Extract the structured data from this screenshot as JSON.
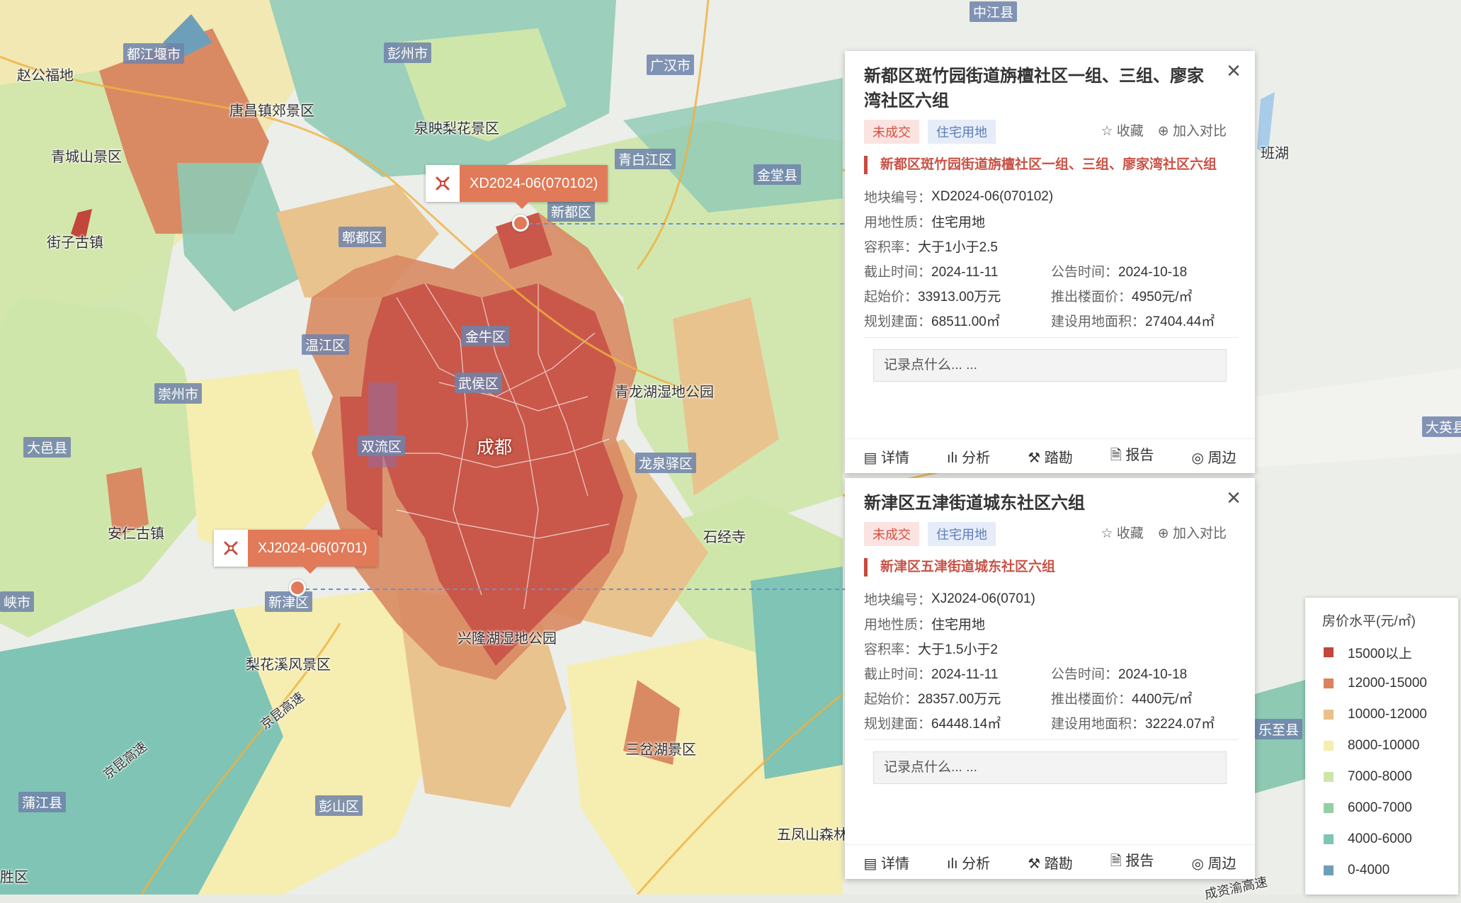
{
  "map_labels": {
    "places": [
      "赵公福地",
      "唐昌镇郊景区",
      "泉映梨花景区",
      "青城山景区",
      "街子古镇",
      "安仁古镇",
      "青龙湖湿地公园",
      "石经寺",
      "兴隆湖湿地公园",
      "梨花溪风景区",
      "三岔湖景区",
      "五凤山森林",
      "班湖"
    ],
    "districts": [
      "都江堰市",
      "彭州市",
      "广汉市",
      "中江县",
      "青白江区",
      "金堂县",
      "新都区",
      "郫都区",
      "温江区",
      "崇州市",
      "大邑县",
      "双流区",
      "龙泉驿区",
      "新津区",
      "蒲江县",
      "彭山区",
      "金牛区",
      "武侯区",
      "峡市",
      "大英县",
      "乐至县",
      "胜区"
    ],
    "roads": [
      "京昆高速",
      "京昆高速",
      "成资渝高速"
    ],
    "city": "成都"
  },
  "markers": [
    {
      "code": "XD2024-06(070102)",
      "icon": "survey-cross-icon"
    },
    {
      "code": "XJ2024-06(0701)",
      "icon": "survey-cross-icon"
    }
  ],
  "cards": [
    {
      "title": "新都区斑竹园街道旃檀社区一组、三组、廖家湾社区六组",
      "status_tag": "未成交",
      "type_tag": "住宅用地",
      "favorite": "收藏",
      "compare": "加入对比",
      "subtitle": "新都区斑竹园街道旃檀社区一组、三组、廖家湾社区六组",
      "plot_no_label": "地块编号：",
      "plot_no": "XD2024-06(070102)",
      "land_use_label": "用地性质：",
      "land_use": "住宅用地",
      "far_label": "容积率：",
      "far": "大于1小于2.5",
      "deadline_label": "截止时间：",
      "deadline": "2024-11-11",
      "announce_label": "公告时间：",
      "announce": "2024-10-18",
      "start_price_label": "起始价：",
      "start_price": "33913.00万元",
      "floor_price_label": "推出楼面价：",
      "floor_price": "4950元/㎡",
      "planned_area_label": "规划建面：",
      "planned_area": "68511.00㎡",
      "land_area_label": "建设用地面积：",
      "land_area": "27404.44㎡",
      "note_placeholder": "记录点什么... ...",
      "actions": [
        "详情",
        "分析",
        "踏勘",
        "报告",
        "周边"
      ]
    },
    {
      "title": "新津区五津街道城东社区六组",
      "status_tag": "未成交",
      "type_tag": "住宅用地",
      "favorite": "收藏",
      "compare": "加入对比",
      "subtitle": "新津区五津街道城东社区六组",
      "plot_no_label": "地块编号：",
      "plot_no": "XJ2024-06(0701)",
      "land_use_label": "用地性质：",
      "land_use": "住宅用地",
      "far_label": "容积率：",
      "far": "大于1.5小于2",
      "deadline_label": "截止时间：",
      "deadline": "2024-11-11",
      "announce_label": "公告时间：",
      "announce": "2024-10-18",
      "start_price_label": "起始价：",
      "start_price": "28357.00万元",
      "floor_price_label": "推出楼面价：",
      "floor_price": "4400元/㎡",
      "planned_area_label": "规划建面：",
      "planned_area": "64448.14㎡",
      "land_area_label": "建设用地面积：",
      "land_area": "32224.07㎡",
      "note_placeholder": "记录点什么... ...",
      "actions": [
        "详情",
        "分析",
        "踏勘",
        "报告",
        "周边"
      ]
    }
  ],
  "legend": {
    "title": "房价水平(元/㎡)",
    "items": [
      {
        "label": "15000以上",
        "color": "#c2463b"
      },
      {
        "label": "12000-15000",
        "color": "#d9825e"
      },
      {
        "label": "10000-12000",
        "color": "#e8c08a"
      },
      {
        "label": "8000-10000",
        "color": "#f6eeb0"
      },
      {
        "label": "7000-8000",
        "color": "#cde6a8"
      },
      {
        "label": "6000-7000",
        "color": "#94cfa2"
      },
      {
        "label": "4000-6000",
        "color": "#7fc4b4"
      },
      {
        "label": "0-4000",
        "color": "#6e9fba"
      }
    ]
  }
}
